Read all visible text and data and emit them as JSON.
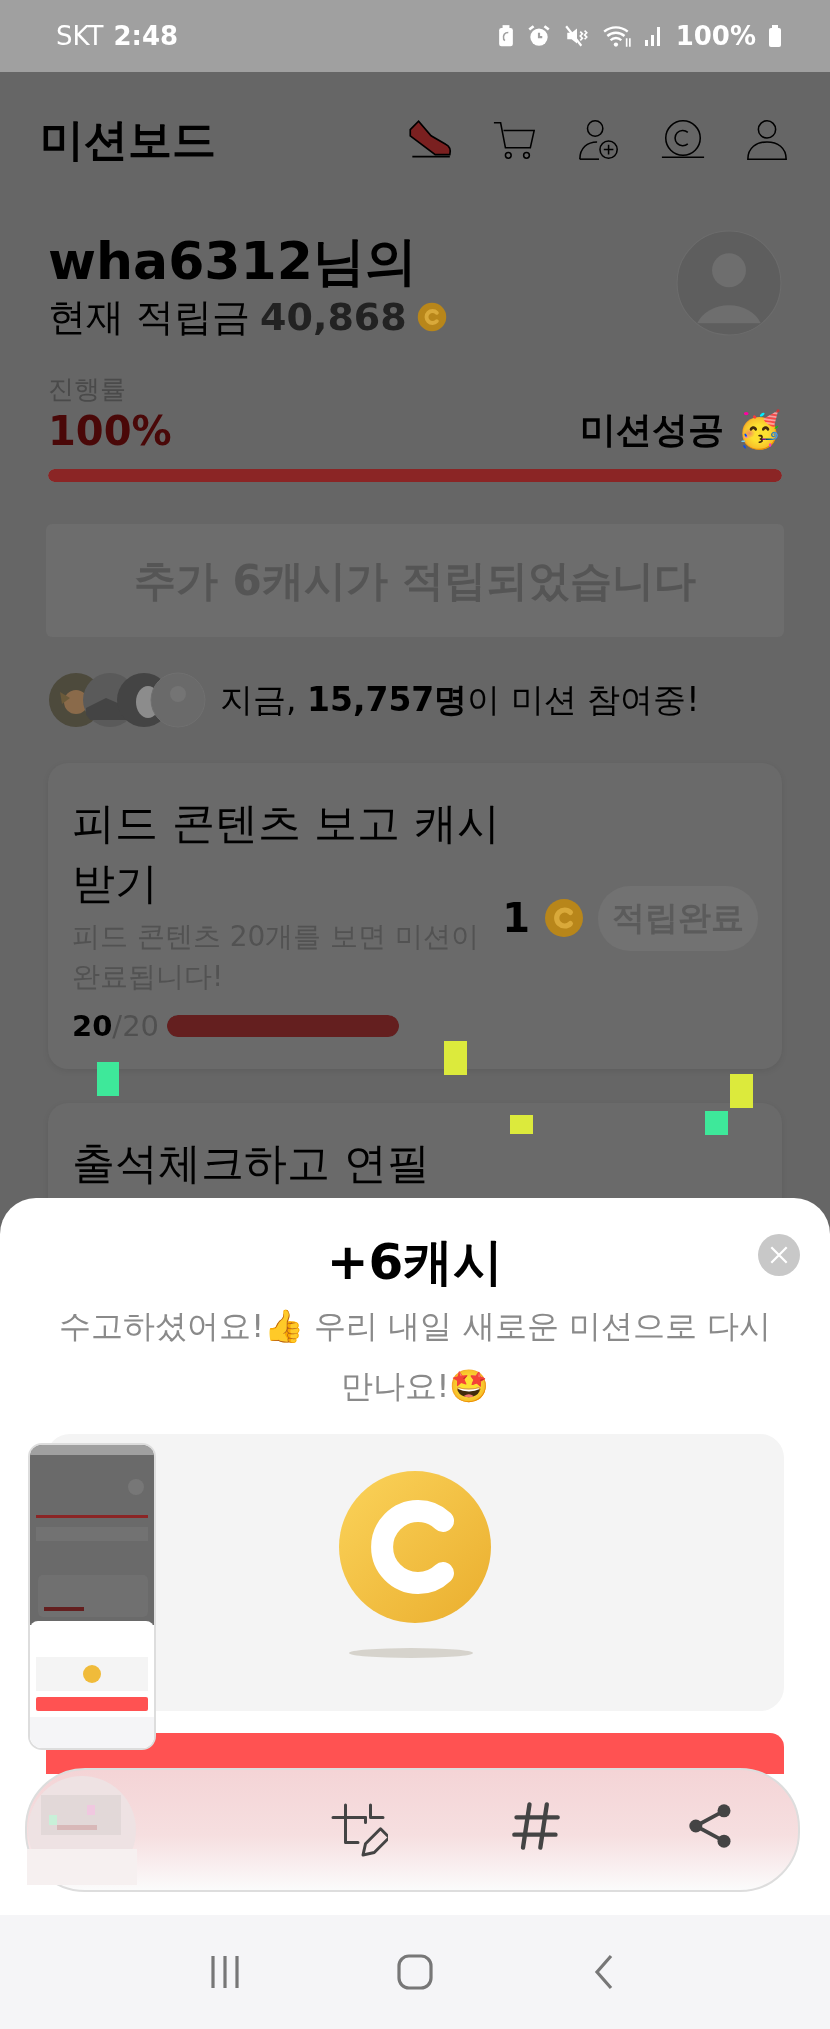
{
  "status_bar": {
    "carrier": "SKT",
    "time": "2:48",
    "battery": "100%"
  },
  "header": {
    "title": "미션보드"
  },
  "summary": {
    "username": "wha6312님의",
    "balance_label": "현재 적립금",
    "balance": "40,868",
    "progress_label": "진행률",
    "progress_value": "100%",
    "status": "미션성공 🥳",
    "level": 1
  },
  "banner": {
    "text": "추가 6캐시가 적립되었습니다"
  },
  "participants": {
    "text": "지금, **15,757명**이 미션 참여중!",
    "avatars": [
      {
        "kind": "picture"
      },
      {
        "kind": "picture"
      },
      {
        "kind": "picture"
      },
      {
        "kind": "placeholder"
      }
    ]
  },
  "missions": [
    {
      "title": "피드 콘텐츠 보고 캐시 받기",
      "description": "피드 콘텐츠 20개를 보면 미션이 완료됩니다!",
      "reward": "1",
      "button": "적립완료",
      "count": "**20**/20",
      "level": 1
    },
    {
      "title": "출석체크하고 연필"
    }
  ],
  "sheet": {
    "title": "+6캐시",
    "message": "수고하셨어요!👍 우리 내일 새로운 미션으로 다시 만나요!🤩",
    "thumbnail": {
      "kind": "picture"
    }
  }
}
